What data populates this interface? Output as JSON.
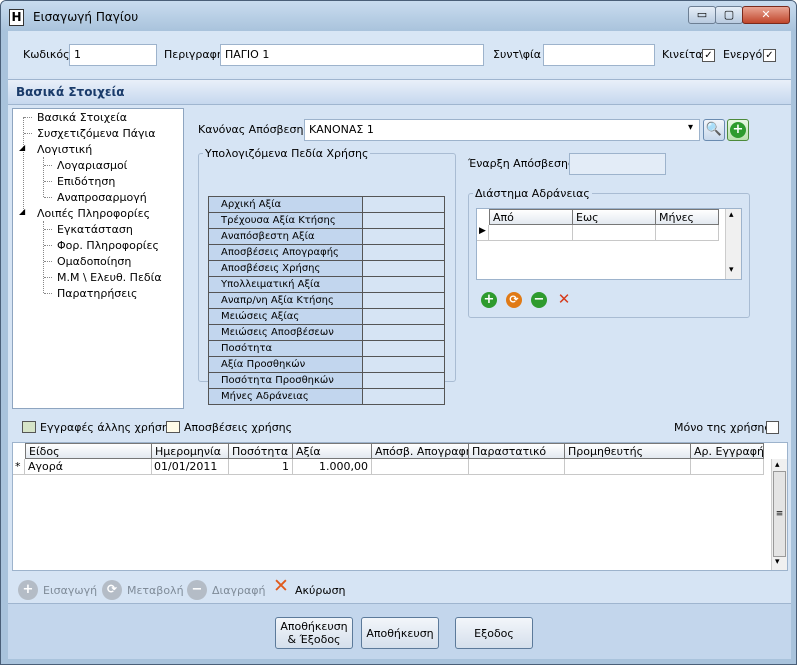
{
  "window": {
    "title": "Εισαγωγή Παγίου",
    "app_icon": "Η",
    "buttons": {
      "minimize": "▭",
      "maximize": "▢",
      "close": "✕"
    }
  },
  "header": {
    "code_label": "Κωδικός",
    "code_value": "1",
    "desc_label": "Περιγραφή",
    "desc_value": "ΠΑΓΙΟ 1",
    "coeff_label": "Συντ\\φία",
    "coeff_value": "",
    "moving_label": "Κινείται",
    "moving_checked": "✓",
    "active_label": "Ενεργό",
    "active_checked": "✓"
  },
  "section_title": "Βασικά Στοιχεία",
  "tree": {
    "items": [
      "Βασικά Στοιχεία",
      "Συσχετιζόμενα Πάγια",
      "Λογιστική",
      "Λογαριασμοί",
      "Επιδότηση",
      "Αναπροσαρμογή",
      "Λοιπές Πληροφορίες",
      "Εγκατάσταση",
      "Φορ. Πληροφορίες",
      "Ομαδοποίηση",
      "Μ.Μ \\ Ελευθ. Πεδία",
      "Παρατηρήσεις"
    ],
    "expander": "◢"
  },
  "depreciation": {
    "rule_label": "Κανόνας Απόσβεσης",
    "rule_value": "ΚΑΝΟΝΑΣ 1",
    "dropdown_arrow": "▾",
    "start_label": "Έναρξη Απόσβεσης",
    "start_value": ""
  },
  "use_fields": {
    "title": "Υπολογιζόμενα Πεδία Χρήσης",
    "rows": [
      "Αρχική Αξία",
      "Τρέχουσα Αξία Κτήσης",
      "Αναπόσβεστη Αξία",
      "Αποσβέσεις Απογραφής",
      "Αποσβέσεις Χρήσης",
      "Υπολλειματική Αξία",
      "Αναπρ/νη Αξία Κτήσης",
      "Μειώσεις Αξίας",
      "Μειώσεις Αποσβέσεων",
      "Ποσότητα",
      "Αξία Προσθηκών",
      "Ποσότητα Προσθηκών",
      "Μήνες Αδράνειας"
    ]
  },
  "inactivity": {
    "title": "Διάστημα Αδράνειας",
    "columns": [
      "Από",
      "Εως",
      "Μήνες"
    ],
    "row_marker": "▶",
    "scroll_up": "▴",
    "scroll_down": "▾"
  },
  "legend": {
    "other_use": "Εγγραφές άλλης χρήσης",
    "depreciations": "Αποσβέσεις χρήσης",
    "only_use_label": "Μόνο της χρήσης"
  },
  "entries": {
    "columns": [
      "Είδος",
      "Ημερομηνία",
      "Ποσότητα",
      "Αξία",
      "Απόσβ. Απογραφής",
      "Παραστατικό",
      "Προμηθευτής",
      "Αρ. Εγγραφής"
    ],
    "rows": [
      {
        "marker": "*",
        "kind": "Αγορά",
        "date": "01/01/2011",
        "qty": "1",
        "value": "1.000,00",
        "dep_inv": "",
        "doc": "",
        "supplier": "",
        "entry_no": ""
      }
    ],
    "scroll_up": "▴",
    "scroll_down": "▾",
    "scroll_grip": "≡"
  },
  "toolbar": {
    "insert": "Εισαγωγή",
    "modify": "Μεταβολή",
    "delete": "Διαγραφή",
    "cancel": "Ακύρωση"
  },
  "footer": {
    "save_exit": "Αποθήκευση\n& Έξοδος",
    "save": "Αποθήκευση",
    "exit": "Εξοδος"
  },
  "colors": {
    "accent": "#1a3b6a",
    "green": "#2e9b2e",
    "orange": "#e07a16",
    "red": "#d63b1c"
  },
  "icons": [
    "search-icon",
    "add-icon",
    "edit-icon",
    "remove-icon",
    "cancel-icon"
  ]
}
